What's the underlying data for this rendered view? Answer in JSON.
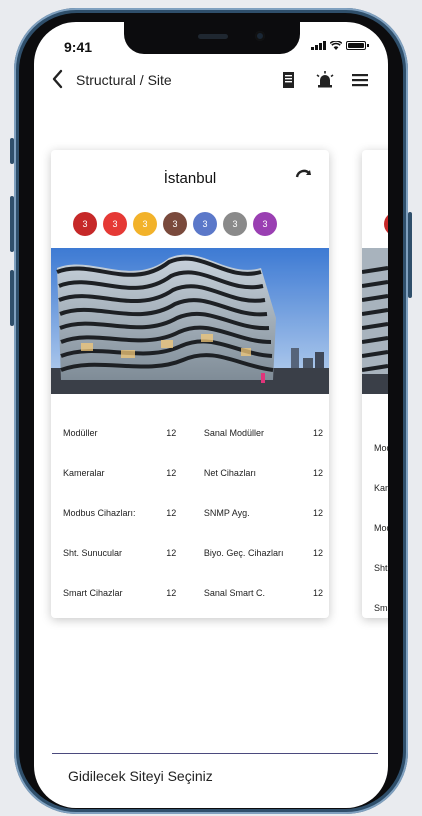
{
  "status": {
    "time": "9:41"
  },
  "nav": {
    "title": "Structural / Site",
    "icons": [
      "back-arrow-icon",
      "document-icon",
      "alarm-light-icon",
      "menu-icon"
    ]
  },
  "site_card": {
    "title": "İstanbul",
    "badges": [
      {
        "value": "3",
        "color": "#c62828"
      },
      {
        "value": "3",
        "color": "#e53935"
      },
      {
        "value": "3",
        "color": "#f2b22a"
      },
      {
        "value": "3",
        "color": "#7a4a3c"
      },
      {
        "value": "3",
        "color": "#5b78c9"
      },
      {
        "value": "3",
        "color": "#8a8a8a"
      },
      {
        "value": "3",
        "color": "#9a3fb2"
      }
    ],
    "stats": [
      {
        "label1": "Modüller",
        "value1": "12",
        "label2": "Sanal Modüller",
        "value2": "12"
      },
      {
        "label1": "Kameralar",
        "value1": "12",
        "label2": "Net Cihazları",
        "value2": "12"
      },
      {
        "label1": "Modbus Cihazları:",
        "value1": "12",
        "label2": "SNMP Ayg.",
        "value2": "12"
      },
      {
        "label1": "Sht. Sunucular",
        "value1": "12",
        "label2": "Biyo. Geç. Cihazları",
        "value2": "12"
      },
      {
        "label1": "Smart Cihazlar",
        "value1": "12",
        "label2": "Sanal Smart C.",
        "value2": "12"
      }
    ]
  },
  "next_card_peek": {
    "rows": [
      "Mod",
      "Kam",
      "Mod",
      "Sht.",
      "Sma"
    ]
  },
  "footer": {
    "label": "Gidilecek Siteyi Seçiniz"
  }
}
